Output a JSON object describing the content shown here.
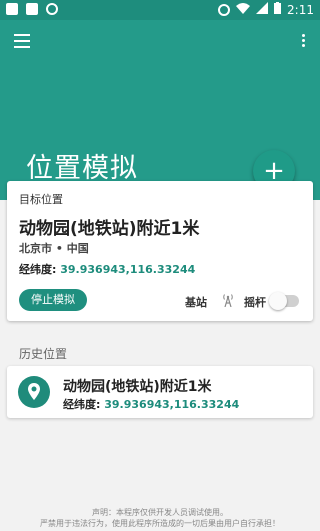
{
  "status_bar": {
    "time": "2:11"
  },
  "app_bar": {
    "title": "位置模拟"
  },
  "fab": {
    "label": "+"
  },
  "target_card": {
    "label": "目标位置",
    "place": "动物园(地铁站)附近1米",
    "region": "北京市 • 中国",
    "coords_label": "经纬度:",
    "coords_value": "39.936943,116.33244",
    "stop_button": "停止模拟",
    "base_station_label": "基站",
    "joystick_label": "摇杆",
    "joystick_enabled": false
  },
  "history": {
    "title": "历史位置",
    "items": [
      {
        "place": "动物园(地铁站)附近1米",
        "coords_label": "经纬度:",
        "coords_value": "39.936943,116.33244"
      }
    ]
  },
  "footer": {
    "line1": "声明：本程序仅供开发人员调试使用。",
    "line2": "严禁用于违法行为，使用此程序所造成的一切后果由用户自行承担！"
  },
  "colors": {
    "primary": "#249b8a",
    "primary_dark": "#1e8d7d",
    "accent": "#1f8f7f"
  }
}
